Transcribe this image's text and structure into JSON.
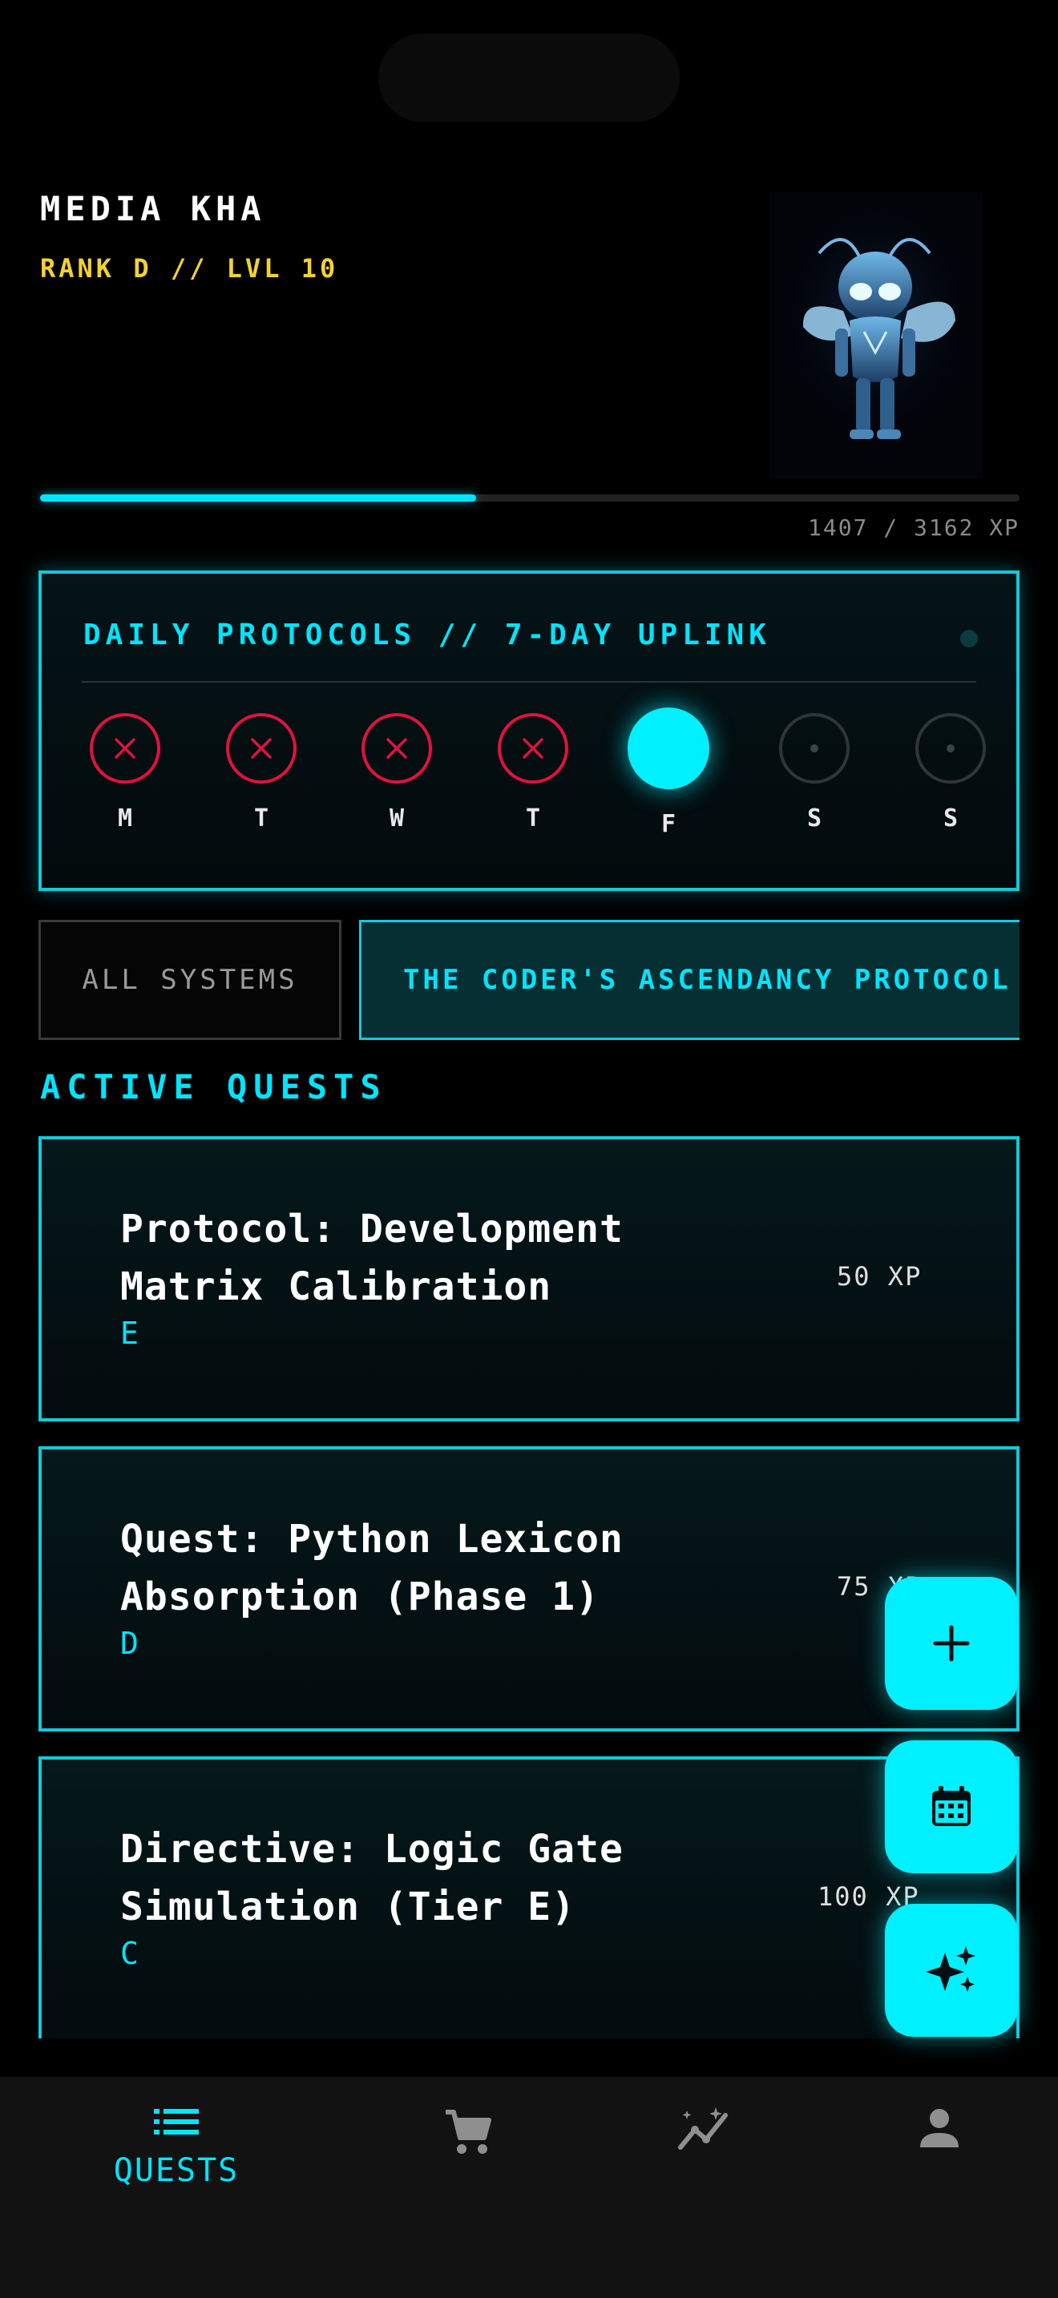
{
  "profile": {
    "name": "MEDIA KHA",
    "rank_line": "RANK D // LVL 10",
    "xp_text": "1407 / 3162 XP",
    "xp_current": 1407,
    "xp_total": 3162
  },
  "protocols": {
    "title": "DAILY PROTOCOLS // 7-DAY UPLINK",
    "days": [
      {
        "label": "M",
        "status": "missed"
      },
      {
        "label": "T",
        "status": "missed"
      },
      {
        "label": "W",
        "status": "missed"
      },
      {
        "label": "T",
        "status": "missed"
      },
      {
        "label": "F",
        "status": "today"
      },
      {
        "label": "S",
        "status": "future"
      },
      {
        "label": "S",
        "status": "future"
      }
    ]
  },
  "filters": {
    "all": "ALL SYSTEMS",
    "active": "THE CODER'S ASCENDANCY PROTOCOL"
  },
  "quests": {
    "section_title": "ACTIVE QUESTS",
    "items": [
      {
        "title": "Protocol: Development Matrix Calibration",
        "rank": "E",
        "xp": "50 XP"
      },
      {
        "title": "Quest: Python Lexicon Absorption (Phase 1)",
        "rank": "D",
        "xp": "75 XP"
      },
      {
        "title": "Directive: Logic Gate Simulation (Tier E)",
        "rank": "C",
        "xp": "100 XP"
      }
    ]
  },
  "fabs": [
    "plus-icon",
    "calendar-icon",
    "sparkles-icon"
  ],
  "nav": {
    "quests_label": "QUESTS",
    "items": [
      "list-icon",
      "cart-icon",
      "analytics-icon",
      "person-icon"
    ]
  },
  "colors": {
    "accent": "#00e5ff",
    "rank": "#f2d22f",
    "missed": "#e0123f",
    "background": "#000000"
  }
}
